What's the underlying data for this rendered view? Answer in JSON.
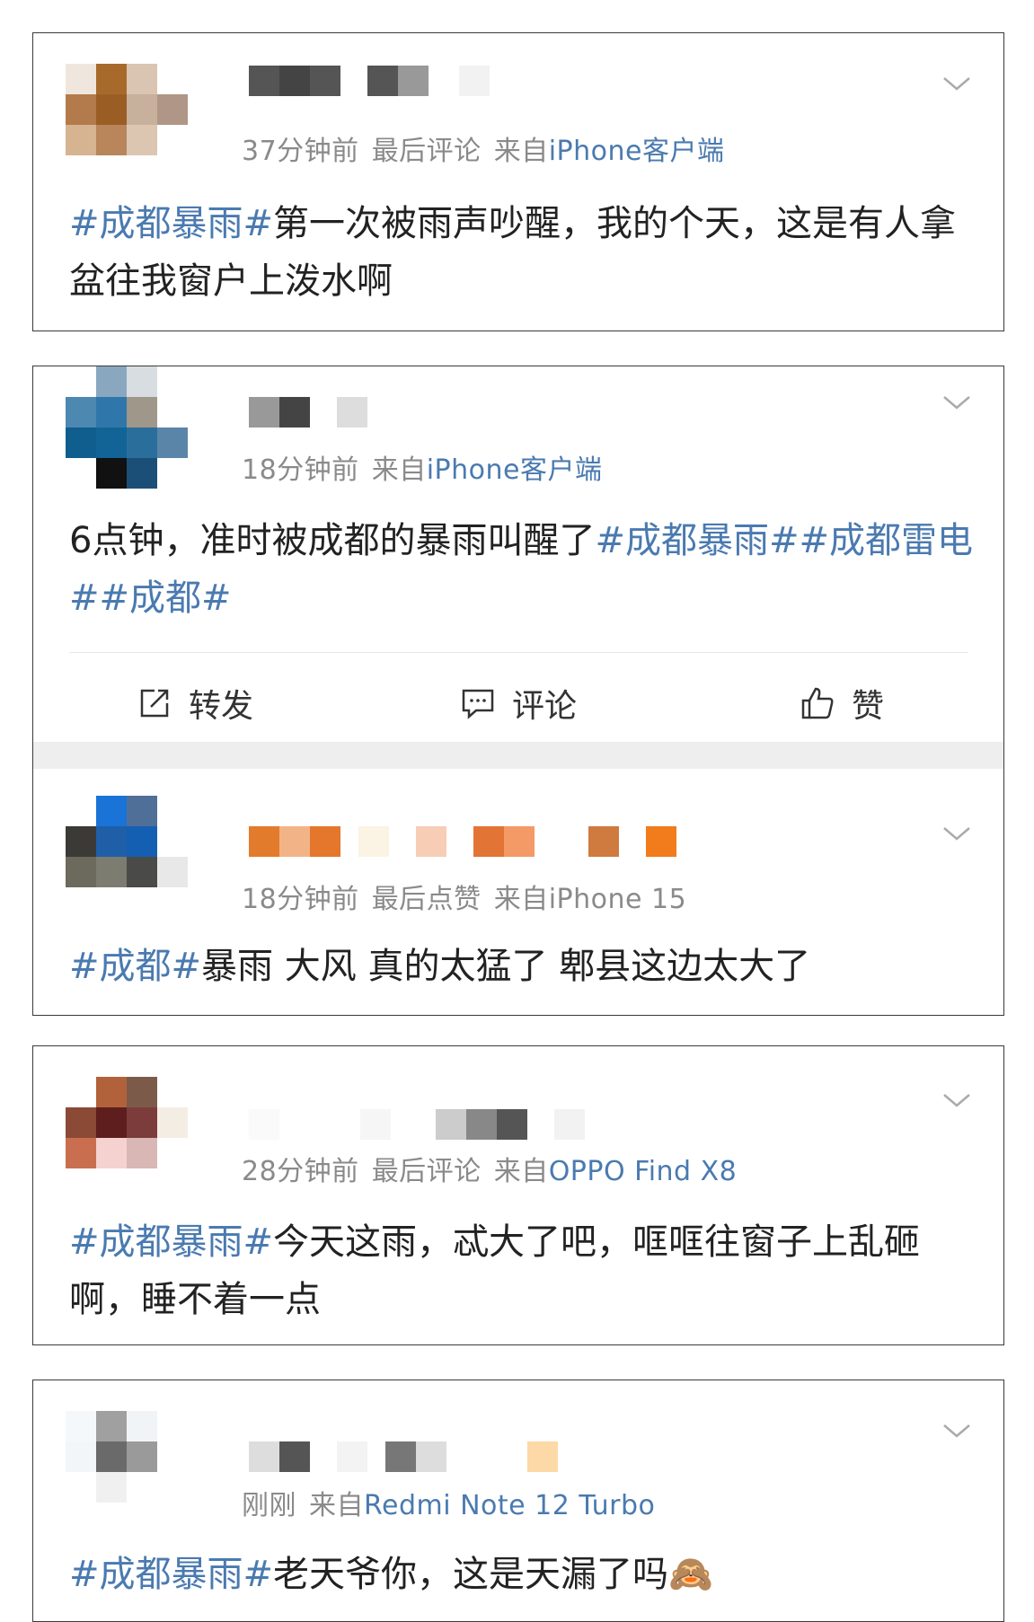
{
  "posts": [
    {
      "meta": {
        "time": "37分钟前",
        "activity": "最后评论",
        "from": "来自",
        "source": "iPhone客户端"
      },
      "text": {
        "tag1": "#成都暴雨#",
        "body": "第一次被雨声吵醒，我的个天，这是有人拿盆往我窗户上泼水啊"
      }
    },
    {
      "meta": {
        "time": "18分钟前",
        "from": "来自",
        "source": "iPhone客户端"
      },
      "text": {
        "body": "6点钟，准时被成都的暴雨叫醒了",
        "tag1": "#成都暴雨#",
        "tag2": "#成都雷电#",
        "tag3": "#成都#"
      },
      "actions": {
        "repost": "转发",
        "comment": "评论",
        "like": "赞"
      }
    },
    {
      "meta": {
        "time": "18分钟前",
        "activity": "最后点赞",
        "from": "来自",
        "source": "iPhone 15"
      },
      "text": {
        "tag1": "#成都#",
        "body": "暴雨 大风 真的太猛了 郫县这边太大了"
      }
    },
    {
      "meta": {
        "time": "28分钟前",
        "activity": "最后评论",
        "from": "来自",
        "source": "OPPO Find X8"
      },
      "text": {
        "tag1": "#成都暴雨#",
        "body": "今天这雨，忒大了吧，哐哐往窗子上乱砸啊，睡不着一点"
      }
    },
    {
      "meta": {
        "time": "刚刚",
        "from": "来自",
        "source": "Redmi Note 12 Turbo"
      },
      "text": {
        "tag1": "#成都暴雨#",
        "body": "老天爷你，这是天漏了吗",
        "emoji": "🙈"
      }
    }
  ],
  "icons": {
    "chevron": "chevron-down-icon",
    "repost": "share-icon",
    "comment": "comment-icon",
    "like": "thumbs-up-icon",
    "emoji": "see-no-evil-monkey"
  },
  "colors": {
    "link": "#4a7ab0",
    "meta": "#8a8a8a",
    "text": "#222222",
    "border": "#3a3a3a"
  }
}
